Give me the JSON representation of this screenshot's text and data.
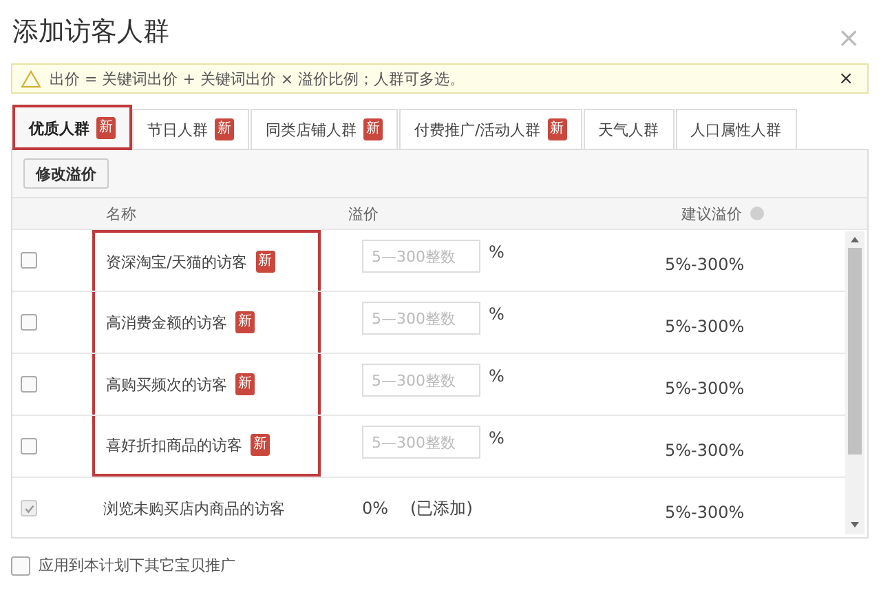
{
  "dialog": {
    "title": "添加访客人群",
    "close": "×"
  },
  "notice": {
    "text": "出价 = 关键词出价 + 关键词出价 × 溢价比例；人群可多选。",
    "close": "×"
  },
  "tabs": [
    {
      "label": "优质人群",
      "badge": "新",
      "selected": true,
      "highlighted": true
    },
    {
      "label": "节日人群",
      "badge": "新",
      "selected": false,
      "highlighted": false
    },
    {
      "label": "同类店铺人群",
      "badge": "新",
      "selected": false,
      "highlighted": false
    },
    {
      "label": "付费推广/活动人群",
      "badge": "新",
      "selected": false,
      "highlighted": false
    },
    {
      "label": "天气人群",
      "selected": false,
      "highlighted": false
    },
    {
      "label": "人口属性人群",
      "selected": false,
      "highlighted": false
    }
  ],
  "toolbar": {
    "button": "修改溢价"
  },
  "table": {
    "columns": [
      "名称",
      "溢价",
      "建议溢价"
    ],
    "rows": [
      {
        "kind": "input",
        "checked": false,
        "disabled": false,
        "highlighted": true,
        "name": "资深淘宝/天猫的访客",
        "badge": "新",
        "placeholder": "5—300整数",
        "unit": "%",
        "suggested": "5%-300%"
      },
      {
        "kind": "input",
        "checked": false,
        "disabled": false,
        "highlighted": true,
        "name": "高消费金额的访客",
        "badge": "新",
        "placeholder": "5—300整数",
        "unit": "%",
        "suggested": "5%-300%"
      },
      {
        "kind": "input",
        "checked": false,
        "disabled": false,
        "highlighted": true,
        "name": "高购买频次的访客",
        "badge": "新",
        "placeholder": "5—300整数",
        "unit": "%",
        "suggested": "5%-300%"
      },
      {
        "kind": "input",
        "checked": false,
        "disabled": false,
        "highlighted": true,
        "name": "喜好折扣商品的访客",
        "badge": "新",
        "placeholder": "5—300整数",
        "unit": "%",
        "suggested": "5%-300%"
      },
      {
        "kind": "added",
        "checked": true,
        "disabled": true,
        "highlighted": false,
        "name": "浏览未购买店内商品的访客",
        "premium": "0%",
        "status": "(已添加)",
        "suggested": "5%-300%"
      }
    ]
  },
  "footer": {
    "label": "应用到本计划下其它宝贝推广",
    "checked": false
  }
}
